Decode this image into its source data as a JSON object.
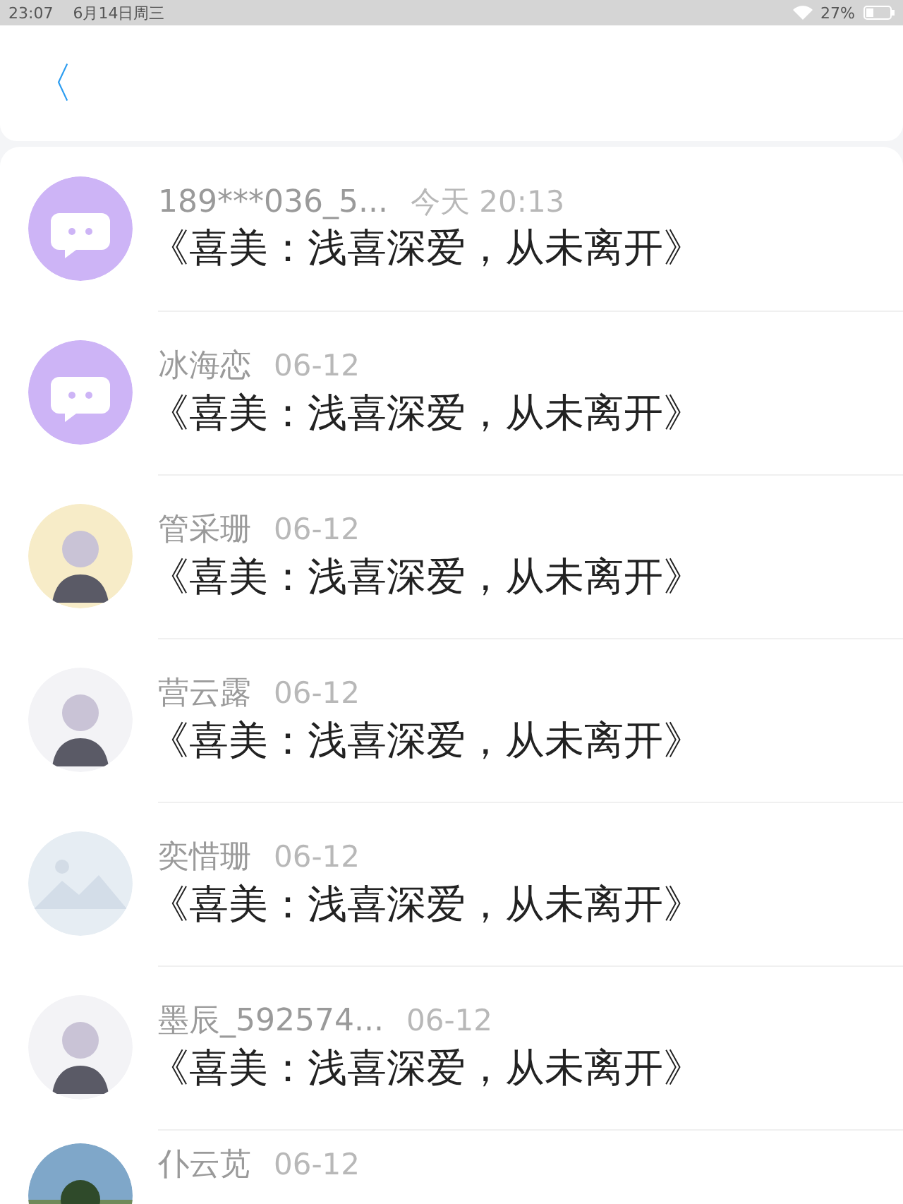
{
  "status_bar": {
    "time": "23:07",
    "date": "6月14日周三",
    "battery": "27%"
  },
  "header": {
    "back": "〈"
  },
  "messages": [
    {
      "name": "189***036_5...",
      "time": "今天 20:13",
      "text": "《喜美：浅喜深爱，从未离开》",
      "avatar": {
        "kind": "bubble",
        "color": "#cdb4f6"
      }
    },
    {
      "name": "冰海恋",
      "time": "06-12",
      "text": "《喜美：浅喜深爱，从未离开》",
      "avatar": {
        "kind": "bubble",
        "color": "#cdb4f6"
      }
    },
    {
      "name": "管采珊",
      "time": "06-12",
      "text": "《喜美：浅喜深爱，从未离开》",
      "avatar": {
        "kind": "figure",
        "color": "#f7ecc8"
      }
    },
    {
      "name": "营云露",
      "time": "06-12",
      "text": "《喜美：浅喜深爱，从未离开》",
      "avatar": {
        "kind": "figure",
        "color": "#f3f3f6"
      }
    },
    {
      "name": "奕惜珊",
      "time": "06-12",
      "text": "《喜美：浅喜深爱，从未离开》",
      "avatar": {
        "kind": "placeholder",
        "color": "#e6edf3"
      }
    },
    {
      "name": "墨辰_592574...",
      "time": "06-12",
      "text": "《喜美：浅喜深爱，从未离开》",
      "avatar": {
        "kind": "figure",
        "color": "#f3f3f6"
      }
    },
    {
      "name": "仆云苋",
      "time": "06-12"
    }
  ]
}
